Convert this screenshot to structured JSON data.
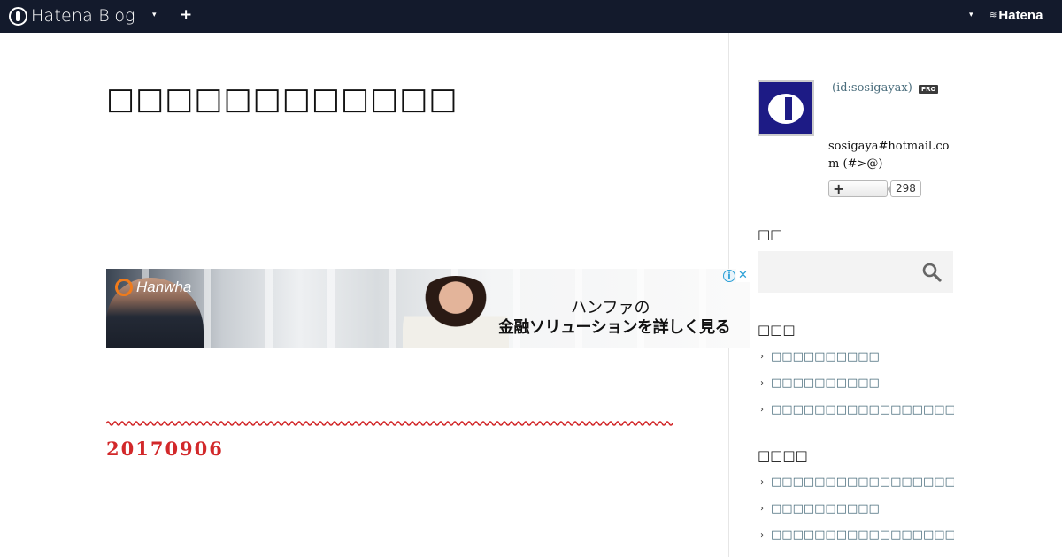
{
  "topbar": {
    "logo_text": "Hatena Blog",
    "menu_caret": "▾",
    "plus": "+",
    "right_caret": "▾",
    "hatena_text": "Hatena"
  },
  "main": {
    "blog_title": "□□□□□□□□□□□□",
    "ad": {
      "brand": "Hanwha",
      "line1": "ハンファの",
      "line2": "金融ソリューションを詳しく見る",
      "adchoices_icon": "i",
      "close_icon": "✕"
    },
    "date": "20170906"
  },
  "sidebar": {
    "profile": {
      "user_id": "(id:sosigayax)",
      "pro_badge": "PRO",
      "description": "sosigaya#hotmail.com (#>@)",
      "subscribe_label": "+",
      "subscriber_count": "298"
    },
    "search": {
      "title": "□□",
      "placeholder": ""
    },
    "links": {
      "title": "□□□",
      "items": [
        "□□□□□□□□□□",
        "□□□□□□□□□□",
        "□□□□□□□□□□□□□□□□□□□□"
      ]
    },
    "recent": {
      "title": "□□□□",
      "items": [
        "□□□□□□□□□□□□□□□□□□□□",
        "□□□□□□□□□□",
        "□□□□□□□□□□□□□□□□□□□□□□"
      ]
    }
  }
}
